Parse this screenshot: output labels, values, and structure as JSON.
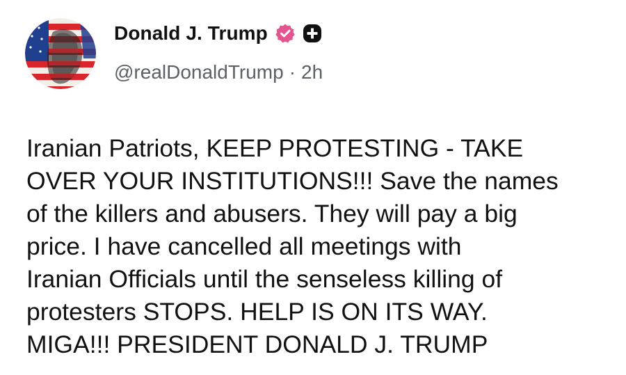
{
  "author": {
    "display_name": "Donald J. Trump",
    "handle": "@realDonaldTrump",
    "separator": "·",
    "time_ago": "2h",
    "avatar_icon": "flag-portrait-avatar",
    "verified_icon": "verified-badge-icon",
    "verified_color": "#e4548f",
    "extra_badge_icon": "plus-badge-icon",
    "extra_badge_color": "#111111"
  },
  "post": {
    "lines": [
      "Iranian Patriots, KEEP PROTESTING - TAKE",
      "OVER YOUR INSTITUTIONS!!! Save the names",
      "of the killers and abusers. They will pay a big",
      "price. I have cancelled all meetings with",
      "Iranian Officials until the senseless killing of",
      "protesters STOPS. HELP IS ON ITS WAY.",
      "MIGA!!! PRESIDENT DONALD J. TRUMP"
    ]
  }
}
